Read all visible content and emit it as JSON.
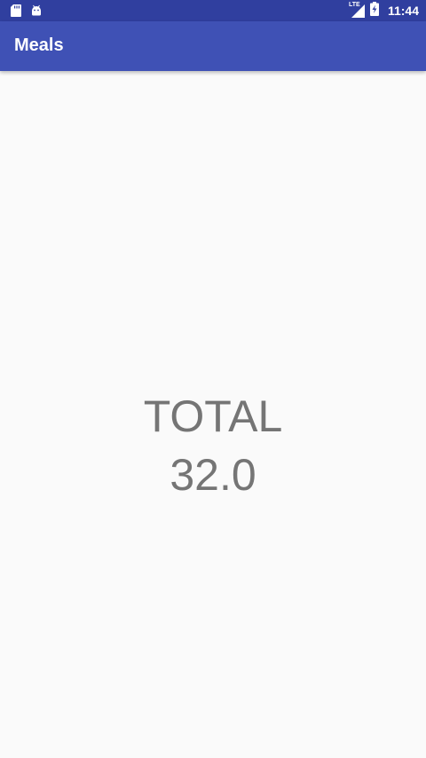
{
  "status_bar": {
    "time": "11:44",
    "network": "LTE",
    "icons": [
      "sd-card-icon",
      "android-icon",
      "signal-icon",
      "battery-charging-icon"
    ],
    "background_color": "#303f9f"
  },
  "app_bar": {
    "title": "Meals",
    "background_color": "#3f51b5"
  },
  "main": {
    "total_label": "TOTAL",
    "total_value": "32.0",
    "text_color": "#757575",
    "background_color": "#fafafa"
  }
}
